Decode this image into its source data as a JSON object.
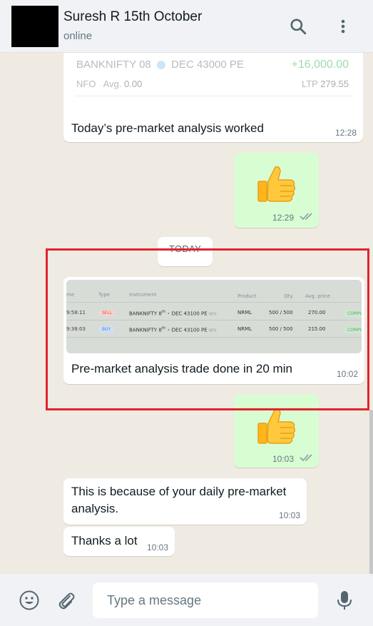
{
  "header": {
    "contact_name": "Suresh R 15th October",
    "status": "online",
    "icons": [
      "search-icon",
      "menu-dots-icon"
    ]
  },
  "messages": {
    "m1": {
      "quoted_instrument": "BANKNIFTY 08",
      "quoted_instrument_rest": "DEC 43000 PE",
      "quoted_pnl": "+16,000.00",
      "quoted_exchange": "NFO",
      "quoted_avg_label": "Avg.",
      "quoted_avg": "0.00",
      "quoted_ltp_label": "LTP",
      "quoted_ltp": "279.55",
      "text": "Today’s pre-market analysis worked",
      "time": "12:28"
    },
    "m2": {
      "emoji": "thumbs-up",
      "time": "12:29",
      "ticks": "read"
    },
    "day_separator": "TODAY",
    "m3": {
      "screenshot": {
        "columns": [
          "me",
          "Type",
          "Instrument",
          "Product",
          "Qty.",
          "Avg. price"
        ],
        "rows": [
          {
            "time": "9:58:11",
            "type": "SELL",
            "instrument": "BANKNIFTY 8",
            "sup": "th",
            "contract": "DEC 43100 PE",
            "exch": "NFO",
            "product": "NRML",
            "qty": "500 / 500",
            "price": "270.00",
            "status": "COMPL"
          },
          {
            "time": "9:38:03",
            "type": "BUY",
            "instrument": "BANKNIFTY 8",
            "sup": "th",
            "contract": "DEC 43100 PE",
            "exch": "NFO",
            "product": "NRML",
            "qty": "500 / 500",
            "price": "215.00",
            "status": "COMPL"
          }
        ]
      },
      "text": "Pre-market analysis trade done in 20 min",
      "time": "10:02"
    },
    "m4": {
      "emoji": "thumbs-up",
      "time": "10:03",
      "ticks": "read"
    },
    "m5": {
      "line1": "This is because of your daily pre-market",
      "line2": "analysis.",
      "time": "10:03"
    },
    "m6": {
      "text": "Thanks a lot",
      "time": "10:03"
    }
  },
  "composer": {
    "placeholder": "Type a message",
    "icons": [
      "emoji-icon",
      "attach-icon",
      "mic-icon"
    ]
  },
  "colors": {
    "incoming": "#ffffff",
    "outgoing": "#d9fdd3",
    "highlight_box": "#e0242c",
    "pnl_green": "#4fbf63"
  }
}
